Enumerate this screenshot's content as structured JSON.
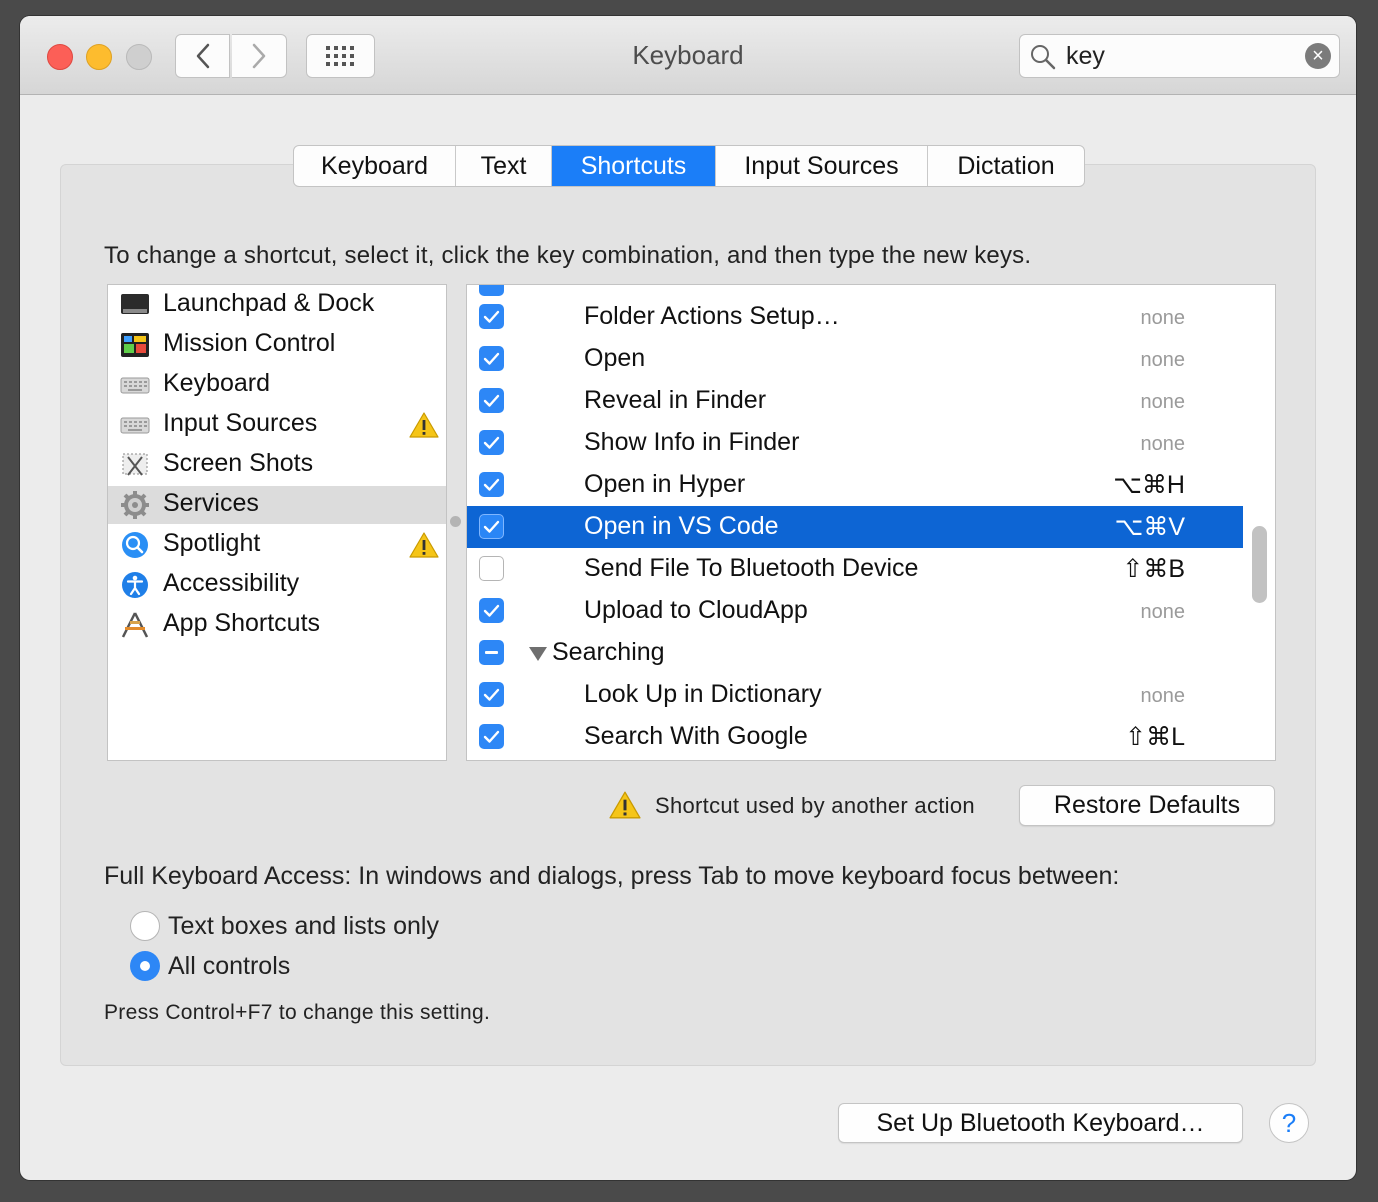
{
  "window": {
    "title": "Keyboard"
  },
  "search": {
    "value": "key"
  },
  "tabs": [
    {
      "label": "Keyboard",
      "active": false
    },
    {
      "label": "Text",
      "active": false
    },
    {
      "label": "Shortcuts",
      "active": true
    },
    {
      "label": "Input Sources",
      "active": false
    },
    {
      "label": "Dictation",
      "active": false
    }
  ],
  "instructions": "To change a shortcut, select it, click the key combination, and then type the new keys.",
  "categories": [
    {
      "label": "Launchpad & Dock",
      "icon": "launchpad-dock-icon"
    },
    {
      "label": "Mission Control",
      "icon": "mission-control-icon"
    },
    {
      "label": "Keyboard",
      "icon": "keyboard-icon"
    },
    {
      "label": "Input Sources",
      "icon": "keyboard-icon",
      "warning": true
    },
    {
      "label": "Screen Shots",
      "icon": "screenshot-icon"
    },
    {
      "label": "Services",
      "icon": "gear-icon",
      "selected": true
    },
    {
      "label": "Spotlight",
      "icon": "spotlight-icon",
      "warning": true
    },
    {
      "label": "Accessibility",
      "icon": "accessibility-icon"
    },
    {
      "label": "App Shortcuts",
      "icon": "app-shortcuts-icon"
    }
  ],
  "shortcuts": [
    {
      "name": "Folder Actions Setup…",
      "keys": "none",
      "state": "checked"
    },
    {
      "name": "Open",
      "keys": "none",
      "state": "checked"
    },
    {
      "name": "Reveal in Finder",
      "keys": "none",
      "state": "checked"
    },
    {
      "name": "Show Info in Finder",
      "keys": "none",
      "state": "checked"
    },
    {
      "name": "Open in Hyper",
      "keys": "⌥⌘H",
      "state": "checked"
    },
    {
      "name": "Open in VS Code",
      "keys": "⌥⌘V",
      "state": "checked",
      "selected": true
    },
    {
      "name": "Send File To Bluetooth Device",
      "keys": "⇧⌘B",
      "state": "unchecked"
    },
    {
      "name": "Upload to CloudApp",
      "keys": "none",
      "state": "checked"
    },
    {
      "name": "Searching",
      "keys": "",
      "state": "mixed",
      "group": true
    },
    {
      "name": "Look Up in Dictionary",
      "keys": "none",
      "state": "checked"
    },
    {
      "name": "Search With Google",
      "keys": "⇧⌘L",
      "state": "checked"
    }
  ],
  "legend": "Shortcut used by another action",
  "restore_label": "Restore Defaults",
  "full_keyboard_access": {
    "label": "Full Keyboard Access: In windows and dialogs, press Tab to move keyboard focus between:",
    "options": [
      {
        "label": "Text boxes and lists only",
        "selected": false
      },
      {
        "label": "All controls",
        "selected": true
      }
    ],
    "note": "Press Control+F7 to change this setting."
  },
  "bluetooth_label": "Set Up Bluetooth Keyboard…",
  "help_label": "?",
  "colors": {
    "accent": "#1b7ef8",
    "selection": "#0d65d4",
    "warning": "#f5c518"
  }
}
